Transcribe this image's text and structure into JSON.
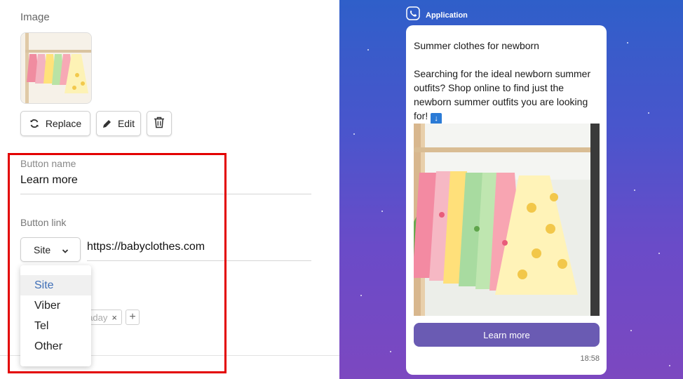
{
  "editor": {
    "image_label": "Image",
    "buttons": {
      "replace": "Replace",
      "edit": "Edit"
    },
    "button_name": {
      "label": "Button name",
      "value": "Learn more"
    },
    "button_link": {
      "label": "Button link",
      "type_selected": "Site",
      "url": "https://babyclothes.com",
      "options": [
        "Site",
        "Viber",
        "Tel",
        "Other"
      ]
    },
    "tag": {
      "text": "aday",
      "remove": "×",
      "add": "+"
    }
  },
  "preview": {
    "app_name": "Application",
    "message": {
      "title": "Summer clothes for newborn",
      "body": "Searching for the ideal newborn summer outfits? Shop online to find just the newborn summer outfits you are looking for!",
      "emoji": "↓"
    },
    "cta_label": "Learn more",
    "time": "18:58"
  },
  "colors": {
    "highlight": "#e30000",
    "cta": "#6a5bb3",
    "dropdown_active": "#3f6fb7",
    "preview_bg_top": "#2f5fc9",
    "preview_bg_bottom": "#7c48c0"
  },
  "icons": {
    "replace": "refresh-icon",
    "edit": "pencil-icon",
    "delete": "trash-icon",
    "select": "chevron-down-icon",
    "app": "viber-icon"
  }
}
